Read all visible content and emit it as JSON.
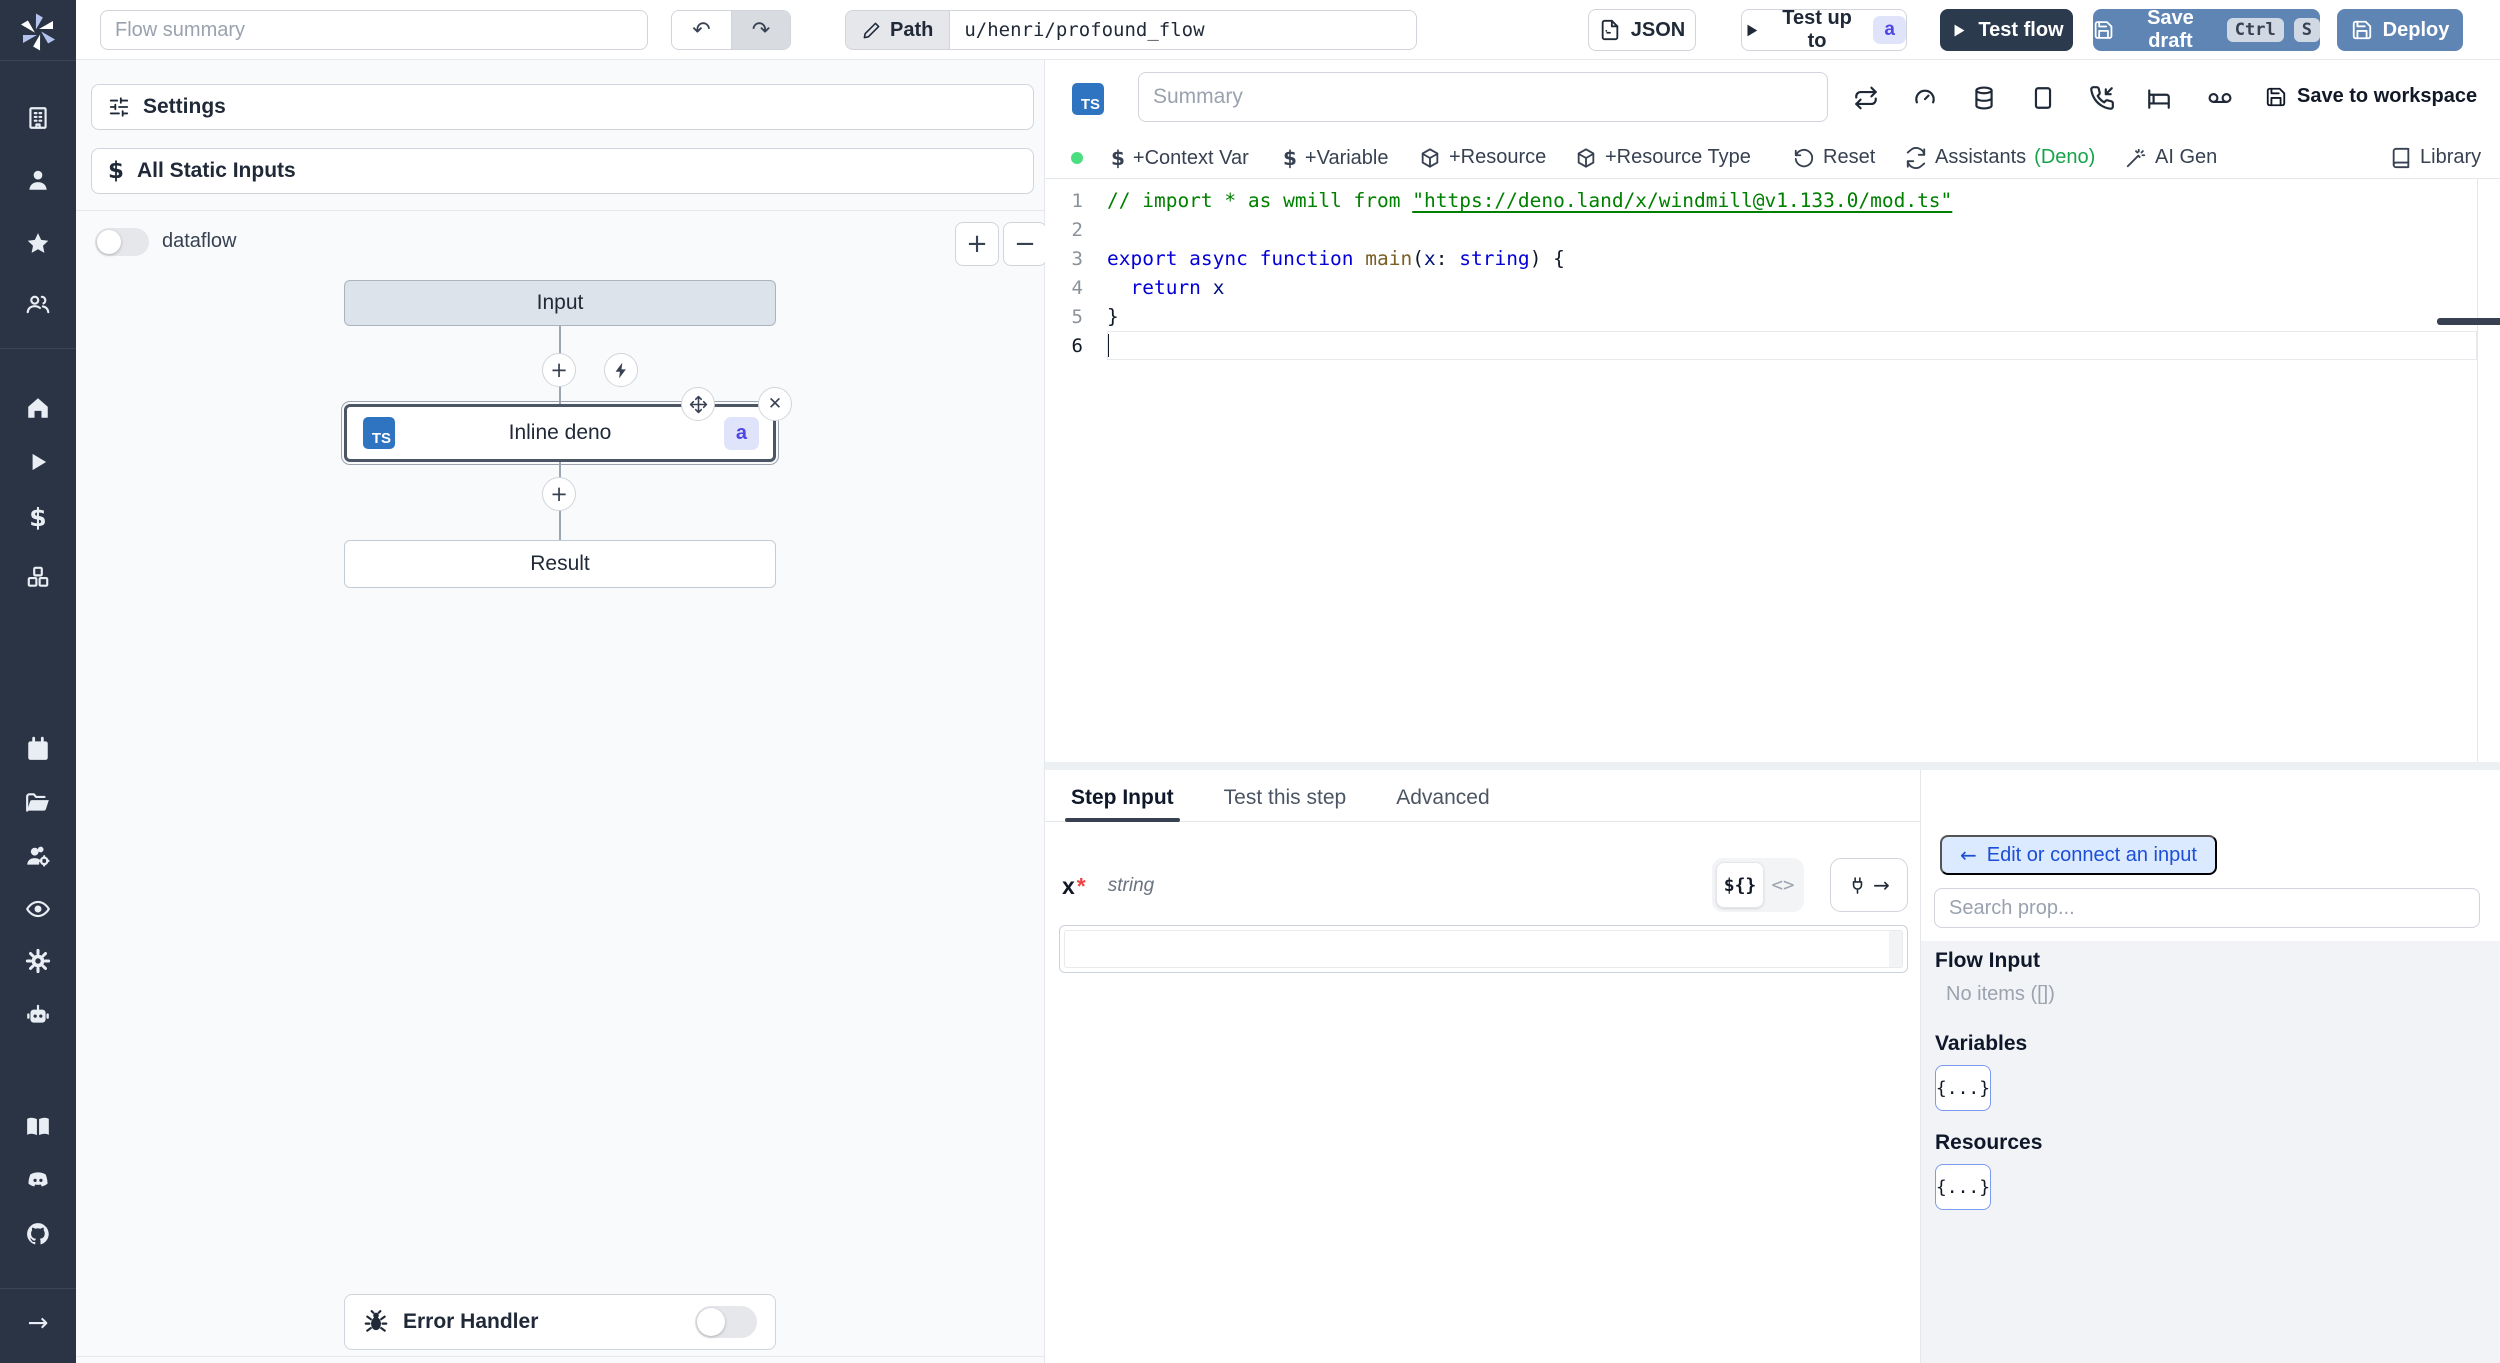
{
  "topbar": {
    "flow_summary_placeholder": "Flow summary",
    "path_label": "Path",
    "path_value": "u/henri/profound_flow",
    "json_label": "JSON",
    "test_up_to_label": "Test up to",
    "test_up_to_badge": "a",
    "test_flow_label": "Test flow",
    "save_draft_label": "Save draft",
    "kbd_ctrl": "Ctrl",
    "kbd_s": "S",
    "deploy_label": "Deploy"
  },
  "icons": {
    "undo": "↶",
    "redo": "↷",
    "plus": "+",
    "minus": "−",
    "close": "✕",
    "arrow_left": "←",
    "arrow_right": "→",
    "dollar": "$",
    "braces": "{...}",
    "expr_toggle": "${}",
    "code_toggle": "<>"
  },
  "sidebar": {
    "icons": [
      "windmill-logo",
      "building",
      "user",
      "star",
      "users",
      "home",
      "play",
      "dollar",
      "boxes",
      "calendar",
      "folder-open",
      "users-cog",
      "eye",
      "gear",
      "bot",
      "book",
      "discord",
      "github",
      "arrow-right"
    ]
  },
  "flow_panel": {
    "settings_label": "Settings",
    "static_inputs_label": "All Static Inputs",
    "dataflow_label": "dataflow",
    "nodes": {
      "input": "Input",
      "step_lang": "TS",
      "step_title": "Inline deno",
      "step_badge": "a",
      "result": "Result"
    },
    "error_handler_label": "Error Handler"
  },
  "editor": {
    "lang_chip": "TS",
    "summary_placeholder": "Summary",
    "save_to_workspace": "Save to workspace",
    "toolbar": {
      "context_var": "+Context Var",
      "variable": "+Variable",
      "resource": "+Resource",
      "resource_type": "+Resource Type",
      "reset": "Reset",
      "assistants": "Assistants",
      "assistants_lang": "(Deno)",
      "ai_gen": "AI Gen",
      "library": "Library"
    },
    "code": {
      "lines": [
        {
          "n": "1",
          "segs": [
            {
              "c": "comment",
              "t": "// import * as wmill from "
            },
            {
              "c": "link",
              "t": "\"https://deno.land/x/windmill@v1.133.0/mod.ts\""
            }
          ]
        },
        {
          "n": "2",
          "segs": []
        },
        {
          "n": "3",
          "segs": [
            {
              "c": "kw",
              "t": "export async function "
            },
            {
              "c": "fn",
              "t": "main"
            },
            {
              "c": "plain",
              "t": "("
            },
            {
              "c": "var",
              "t": "x"
            },
            {
              "c": "plain",
              "t": ": "
            },
            {
              "c": "type",
              "t": "string"
            },
            {
              "c": "plain",
              "t": ") {"
            }
          ]
        },
        {
          "n": "4",
          "segs": [
            {
              "c": "plain",
              "t": "  "
            },
            {
              "c": "kw",
              "t": "return"
            },
            {
              "c": "plain",
              "t": " "
            },
            {
              "c": "var",
              "t": "x"
            }
          ]
        },
        {
          "n": "5",
          "segs": [
            {
              "c": "plain",
              "t": "}"
            }
          ]
        },
        {
          "n": "6",
          "segs": [],
          "cursor": true,
          "active": true
        }
      ]
    }
  },
  "step_panel": {
    "tabs": [
      {
        "label": "Step Input"
      },
      {
        "label": "Test this step"
      },
      {
        "label": "Advanced"
      }
    ],
    "field": {
      "name": "x",
      "required": "*",
      "type": "string"
    }
  },
  "connect_panel": {
    "edit_connect_label": "Edit or connect an input",
    "search_placeholder": "Search prop...",
    "flow_input_title": "Flow Input",
    "flow_input_empty": "No items ([])",
    "variables_title": "Variables",
    "resources_title": "Resources"
  },
  "colors": {
    "sidebar_bg": "#2b3444",
    "accent_blue": "#5f85b5",
    "dark_button": "#2c3a4d",
    "badge_bg": "#e0e4fb",
    "badge_text": "#4f46e5",
    "connect_bg": "#dbeafe",
    "connect_text": "#1d4ed8",
    "deno_green": "#16a34a",
    "dot_green": "#4ade80",
    "ts_blue": "#2f74c0"
  }
}
